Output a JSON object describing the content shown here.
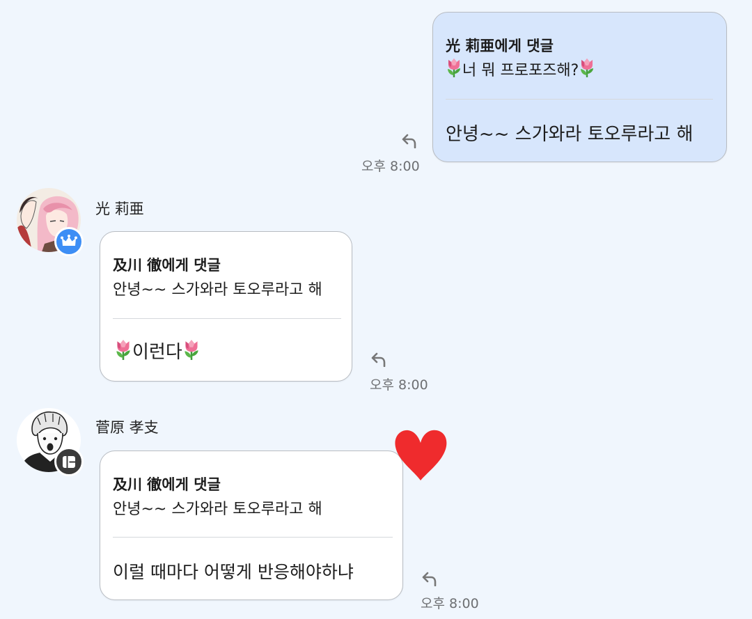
{
  "messages": [
    {
      "sender": "",
      "reply_to": "光 莉亜에게 댓글",
      "quote": "너 뭐 프로포즈해?",
      "text": "안녕~~ 스가와라 토오루라고 해",
      "time": "오후 8:00"
    },
    {
      "sender": "光 莉亜",
      "reply_to": "及川 徹에게 댓글",
      "quote": "안녕~~ 스가와라 토오루라고 해",
      "text": "이런다",
      "time": "오후 8:00"
    },
    {
      "sender": "菅原 孝支",
      "reply_to": "及川 徹에게 댓글",
      "quote": "안녕~~ 스가와라 토오루라고 해",
      "text": "이럴 때마다 어떻게 반응해야하냐",
      "time": "오후 8:00"
    }
  ],
  "icons": {
    "reply": "reply-arrow-icon",
    "tulip": "tulip-emoji-icon",
    "crown_badge": "crown-icon",
    "bot_badge": "bot-icon",
    "heart": "heart-icon"
  },
  "colors": {
    "background": "#f0f6fd",
    "my_bubble": "#d7e6fc",
    "other_bubble": "#ffffff",
    "crown_badge": "#3d8ef5",
    "bot_badge": "#3a3a3a",
    "heart": "#ef2b2d"
  }
}
